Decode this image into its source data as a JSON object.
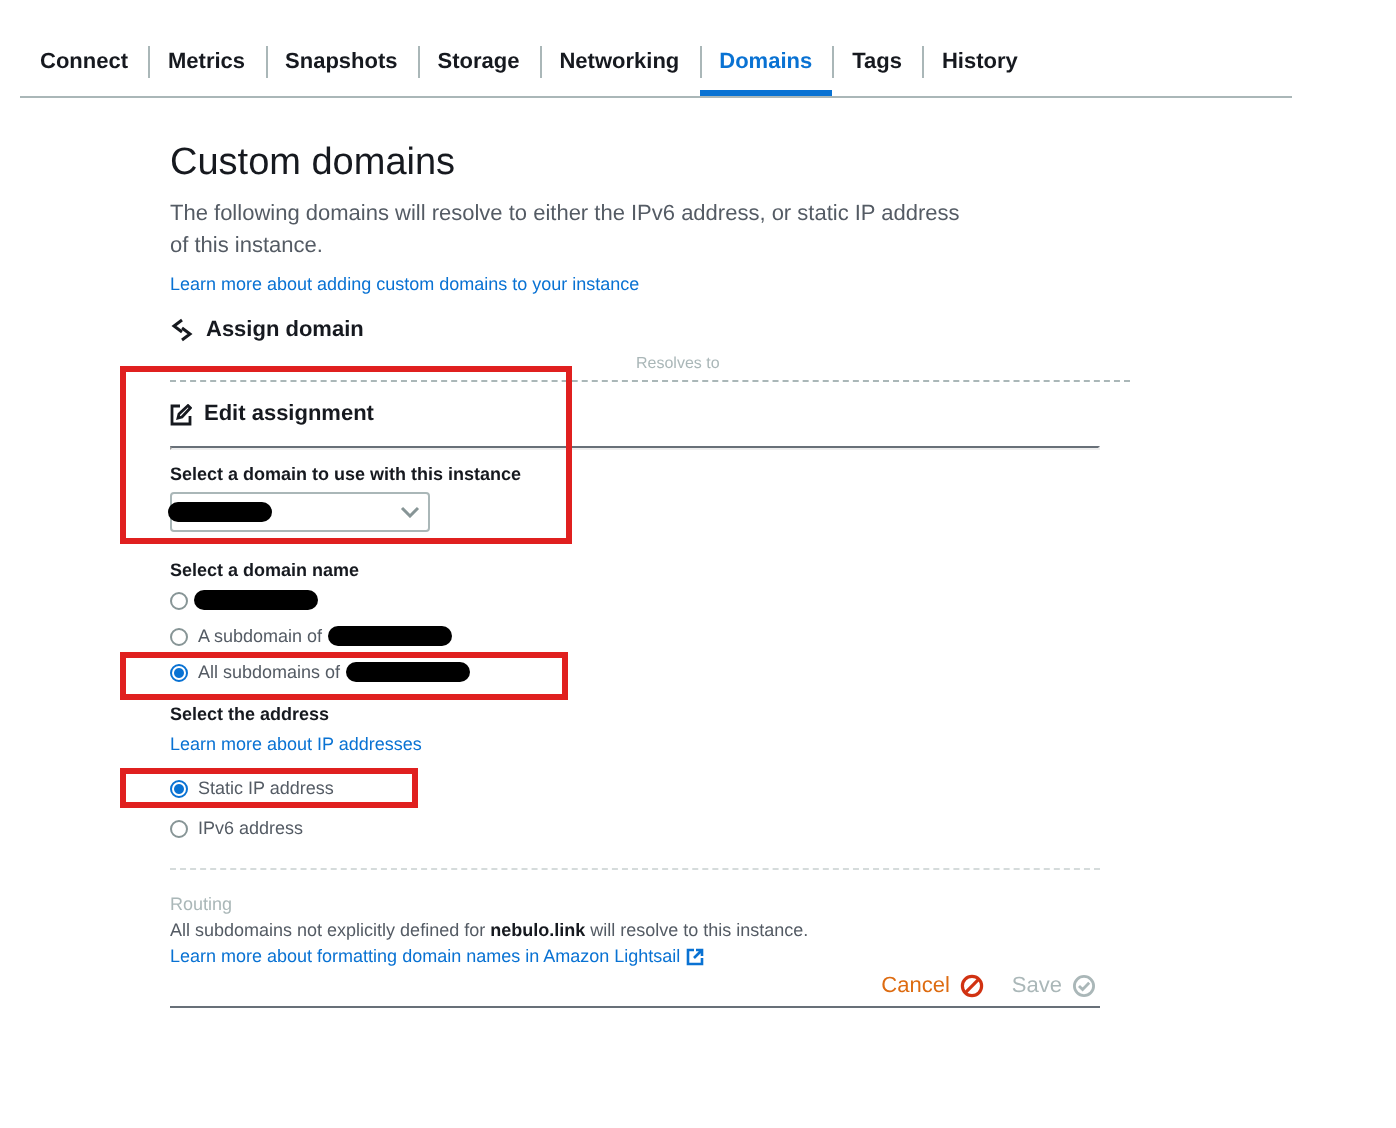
{
  "tabs": [
    {
      "label": "Connect",
      "selected": false
    },
    {
      "label": "Metrics",
      "selected": false
    },
    {
      "label": "Snapshots",
      "selected": false
    },
    {
      "label": "Storage",
      "selected": false
    },
    {
      "label": "Networking",
      "selected": false
    },
    {
      "label": "Domains",
      "selected": true
    },
    {
      "label": "Tags",
      "selected": false
    },
    {
      "label": "History",
      "selected": false
    }
  ],
  "heading": {
    "title": "Custom domains",
    "description": "The following domains will resolve to either the IPv6 address, or static IP address of this instance.",
    "link": "Learn more about adding custom domains to your instance"
  },
  "assign": {
    "title": "Assign domain",
    "column_2": "Resolves to"
  },
  "edit": {
    "title": "Edit assignment",
    "highlighted": true,
    "domain_select": {
      "label": "Select a domain to use with this instance",
      "redacted": true
    }
  },
  "domain_name": {
    "label": "Select a domain name",
    "options": [
      {
        "redacted": true,
        "selected": false,
        "highlighted": false
      },
      {
        "label": "A subdomain of",
        "redacted": true,
        "selected": false,
        "highlighted": false
      },
      {
        "label": "All subdomains of",
        "redacted": true,
        "selected": true,
        "highlighted": true
      }
    ]
  },
  "address": {
    "label": "Select the address",
    "link": "Learn more about IP addresses",
    "options": [
      {
        "label": "Static IP address",
        "selected": true,
        "highlighted": true
      },
      {
        "label": "IPv6 address",
        "selected": false,
        "highlighted": false
      }
    ]
  },
  "routing": {
    "label": "Routing",
    "text": "All subdomains not explicitly defined for **nebulo.link** will resolve to this instance.",
    "link": "Learn more about formatting domain names in Amazon Lightsail"
  },
  "actions": {
    "cancel": "Cancel",
    "save": {
      "label": "Save",
      "disabled": true
    }
  }
}
